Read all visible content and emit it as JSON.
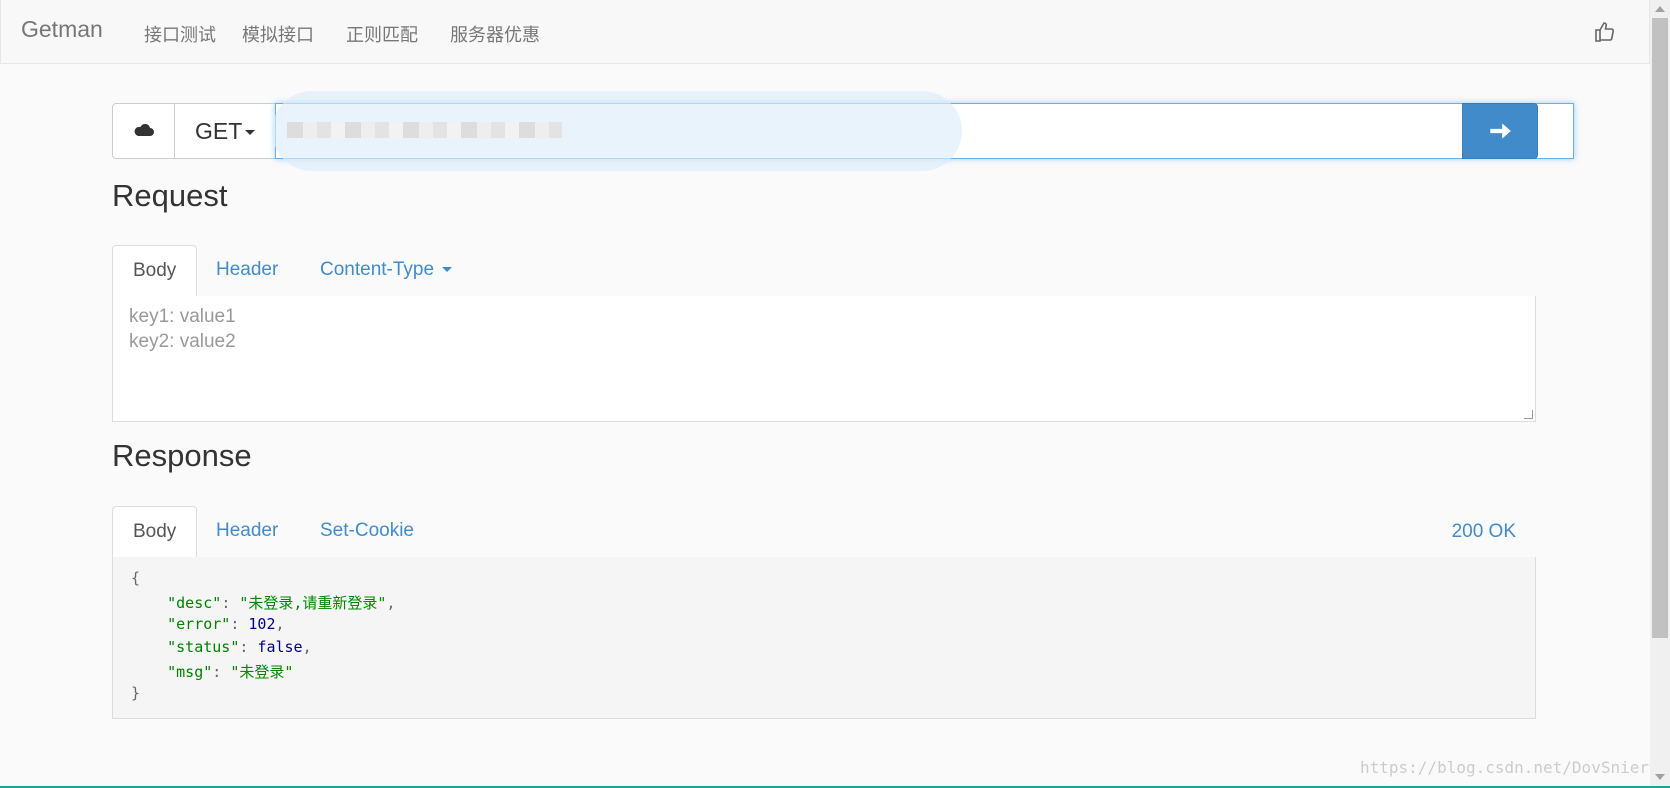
{
  "navbar": {
    "brand": "Getman",
    "links": [
      "接口测试",
      "模拟接口",
      "正则匹配",
      "服务器优惠"
    ]
  },
  "url_bar": {
    "method": "GET",
    "url_value": ""
  },
  "request": {
    "title": "Request",
    "tabs": [
      "Body",
      "Header",
      "Content-Type"
    ],
    "active_tab": "Body",
    "body_placeholder_lines": [
      "key1: value1",
      "key2: value2"
    ]
  },
  "response": {
    "title": "Response",
    "tabs": [
      "Body",
      "Header",
      "Set-Cookie"
    ],
    "active_tab": "Body",
    "status": "200 OK",
    "json": {
      "open": "{",
      "close": "}",
      "desc_key": "\"desc\"",
      "desc_value": "\"未登录,请重新登录\"",
      "error_key": "\"error\"",
      "error_value": "102",
      "status_key": "\"status\"",
      "status_value": "false",
      "msg_key": "\"msg\"",
      "msg_value": "\"未登录\""
    }
  },
  "watermark": "https://blog.csdn.net/DovSnier",
  "colors": {
    "accent": "#428bca",
    "string": "#008800",
    "number": "#000088"
  }
}
